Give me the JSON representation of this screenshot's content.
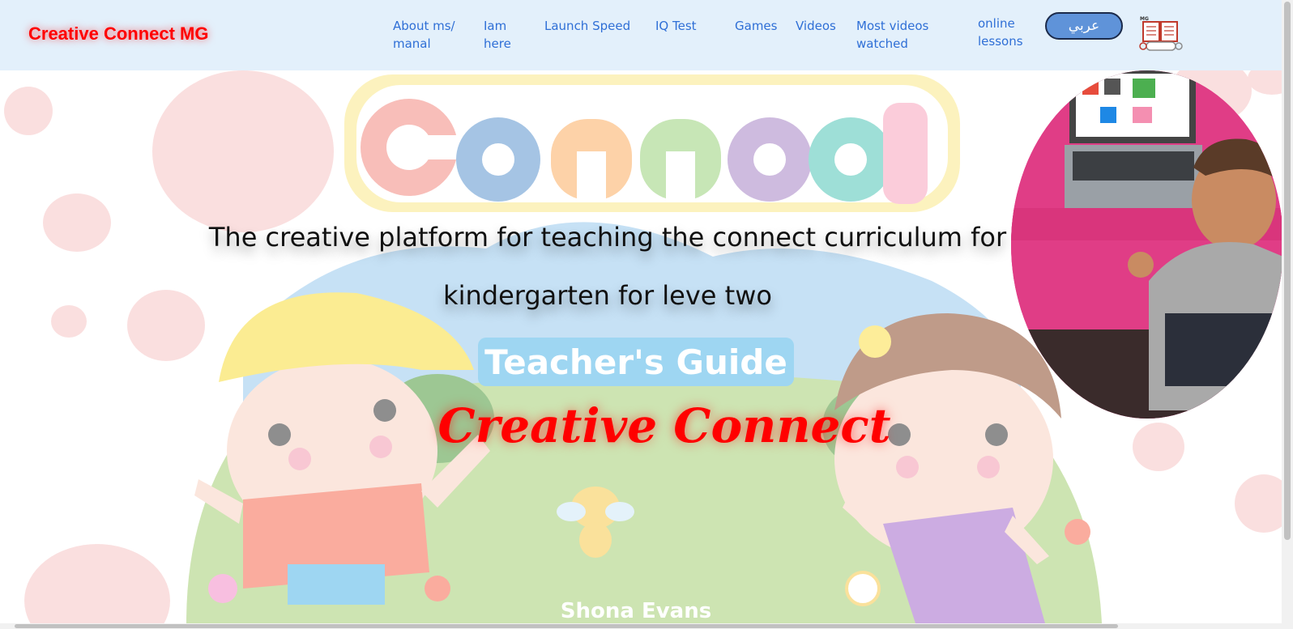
{
  "navbar": {
    "brand": "Creative Connect MG",
    "links": [
      {
        "line1": "About ms/",
        "line2": "manal"
      },
      {
        "line1": "Iam",
        "line2": "here"
      },
      {
        "line1": "Launch Speed",
        "line2": ""
      },
      {
        "line1": "IQ Test",
        "line2": ""
      },
      {
        "line1": "Games",
        "line2": ""
      },
      {
        "line1": "Videos",
        "line2": ""
      },
      {
        "line1": "Most videos",
        "line2": "watched"
      },
      {
        "line1": "online",
        "line2": "lessons"
      }
    ],
    "language_button": "عربي",
    "logo_label": "MG"
  },
  "hero": {
    "art_title": "Connect",
    "art_guide": "Teacher's Guide",
    "art_author": "Shona Evans",
    "headline_line1": "The creative platform for teaching the connect curriculum for",
    "headline_line2": "kindergarten for leve two",
    "subtitle": "Creative Connect"
  },
  "colors": {
    "navbar_bg": "#e3f0fb",
    "brand": "#ff0000",
    "link": "#2f6fd6",
    "button": "#5f93d9",
    "subtitle": "#ff0000"
  },
  "icons": {
    "logo": "book-gamepad-icon"
  }
}
